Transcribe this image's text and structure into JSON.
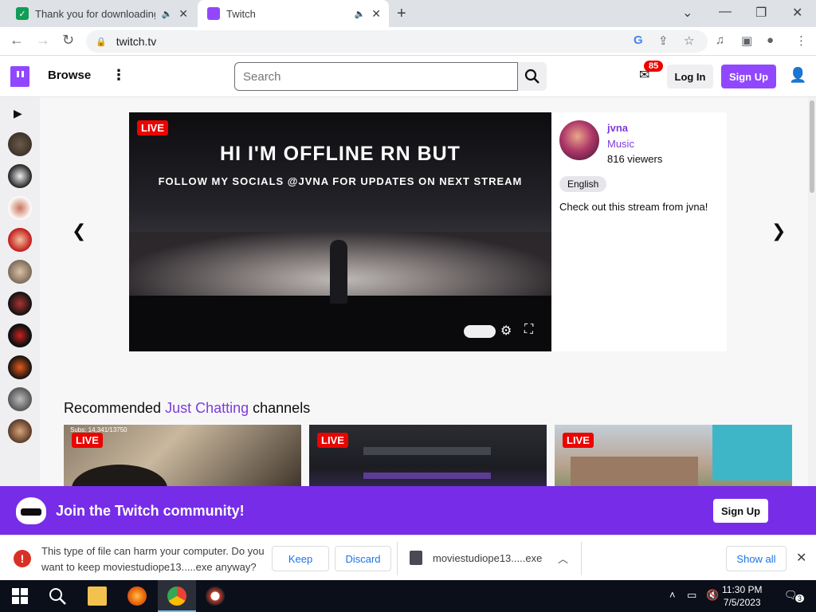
{
  "browser": {
    "tabs": [
      {
        "title": "Thank you for downloading",
        "favicon": "sheets-icon"
      },
      {
        "title": "Twitch",
        "favicon": "twitch-icon"
      }
    ],
    "url": "twitch.tv"
  },
  "header": {
    "browse": "Browse",
    "search_placeholder": "Search",
    "notification_count": "85",
    "login": "Log In",
    "signup": "Sign Up"
  },
  "featured": {
    "live": "LIVE",
    "headline": "HI I'M OFFLINE RN BUT",
    "subline": "FOLLOW MY SOCIALS @JVNA FOR UPDATES ON NEXT STREAM",
    "channel": "jvna",
    "category": "Music",
    "viewers": "816 viewers",
    "tag": "English",
    "description": "Check out this stream from jvna!"
  },
  "recommended": {
    "prefix": "Recommended ",
    "category": "Just Chatting",
    "suffix": " channels",
    "cards": [
      {
        "live": "LIVE",
        "overlay": "Subs: 14,341/13750"
      },
      {
        "live": "LIVE"
      },
      {
        "live": "LIVE"
      }
    ]
  },
  "join": {
    "text": "Join the Twitch community!",
    "button": "Sign Up"
  },
  "download": {
    "message": "This type of file can harm your computer. Do you want to keep moviestudiope13.....exe anyway?",
    "keep": "Keep",
    "discard": "Discard",
    "filename": "moviestudiope13.....exe",
    "show_all": "Show all"
  },
  "taskbar": {
    "time": "11:30 PM",
    "date": "7/5/2023",
    "notifications": "3"
  },
  "colors": {
    "twitch_purple": "#9147ff",
    "join_bar": "#772ce8",
    "live_red": "#eb0400"
  }
}
